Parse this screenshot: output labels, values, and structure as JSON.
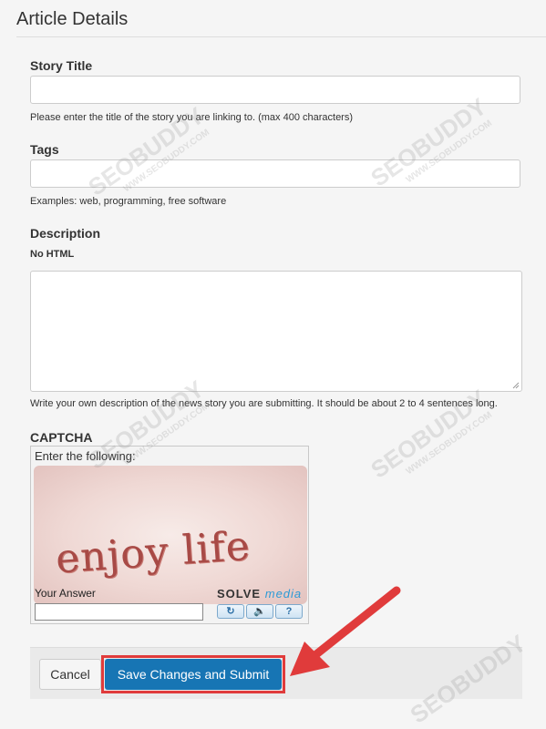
{
  "header": {
    "title": "Article Details"
  },
  "story_title": {
    "label": "Story Title",
    "value": "",
    "help": "Please enter the title of the story you are linking to. (max 400 characters)"
  },
  "tags": {
    "label": "Tags",
    "value": "",
    "help": "Examples: web, programming, free software"
  },
  "description": {
    "label": "Description",
    "note": "No HTML",
    "value": "",
    "help": "Write your own description of the news story you are submitting. It should be about 2 to 4 sentences long."
  },
  "captcha": {
    "label": "CAPTCHA",
    "prompt": "Enter the following:",
    "challenge_text": "enjoy life",
    "answer_label": "Your Answer",
    "answer_value": "",
    "brand_solve": "SOLVE",
    "brand_media": "media",
    "controls": [
      {
        "icon": "refresh-icon",
        "glyph": "↻"
      },
      {
        "icon": "audio-icon",
        "glyph": "🔈"
      },
      {
        "icon": "help-icon",
        "glyph": "?"
      }
    ]
  },
  "actions": {
    "cancel_label": "Cancel",
    "submit_label": "Save Changes and Submit"
  },
  "watermark": {
    "brand": "SEOBUDDY",
    "url": "WWW.SEOBUDDY.COM"
  },
  "colors": {
    "primary": "#1775b4",
    "highlight": "#e03b3b",
    "brand_media": "#2c9ad6"
  }
}
